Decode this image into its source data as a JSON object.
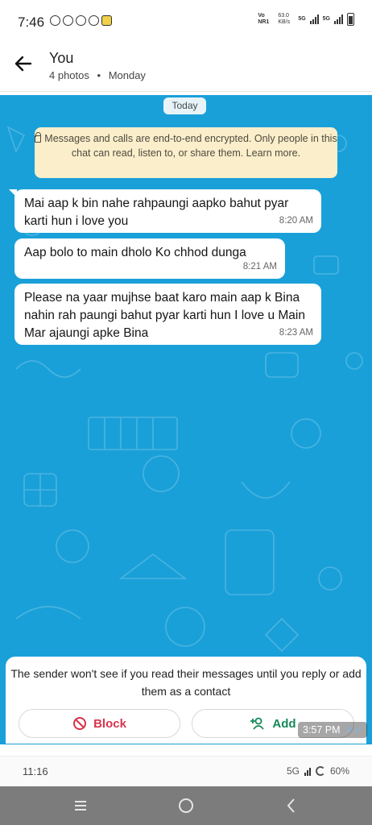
{
  "status_top": {
    "time": "7:46",
    "net_label": "Vo NR1",
    "speed": "63.0 KB/s",
    "net1": "5G",
    "net2": "5G"
  },
  "header": {
    "title": "You",
    "subtitle_count": "4 photos",
    "dot": "•",
    "subtitle_day": "Monday"
  },
  "chat": {
    "background": "#1aa0d8",
    "date_chip": "Today",
    "encryption_notice": "Messages and calls are end-to-end encrypted. Only people in this chat can read, listen to, or share them. Learn more.",
    "messages": [
      {
        "text": "Mai aap k bin nahe rahpaungi aapko bahut pyar karti hun  i love you",
        "time": "8:20 AM"
      },
      {
        "text": "Aap bolo to main dholo Ko chhod dunga",
        "time": "8:21 AM"
      },
      {
        "text": "Please na yaar mujhse baat karo main aap k Bina nahin rah paungi bahut pyar karti hun I love u Main Mar ajaungi apke Bina",
        "time": "8:23 AM"
      }
    ]
  },
  "panel": {
    "notice": "The sender won't see if you read their messages until you reply or add them as a contact",
    "block_label": "Block",
    "add_label": "Add",
    "block_color": "#d7334b",
    "add_color": "#14895a"
  },
  "overlay_time": "3:57 PM",
  "status_bot": {
    "time": "11:16",
    "net": "5G",
    "battery": "60%"
  }
}
